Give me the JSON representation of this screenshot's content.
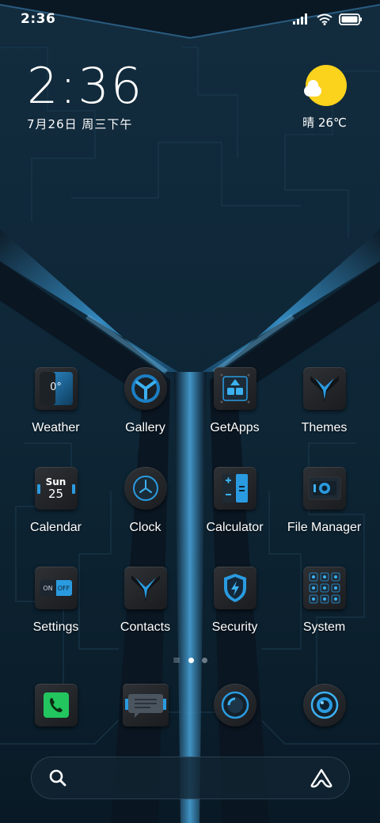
{
  "status_bar": {
    "time": "2:36",
    "icons": [
      "signal-icon",
      "wifi-icon",
      "battery-icon"
    ]
  },
  "clock_widget": {
    "time": "2:36",
    "date": "7月26日 周三下午"
  },
  "weather_widget": {
    "icon": "sun-cloud-icon",
    "text": "晴 26℃"
  },
  "apps": [
    [
      {
        "label": "Weather",
        "icon": "weather-icon",
        "badge": "0°"
      },
      {
        "label": "Gallery",
        "icon": "gallery-icon"
      },
      {
        "label": "GetApps",
        "icon": "getapps-icon"
      },
      {
        "label": "Themes",
        "icon": "themes-icon"
      }
    ],
    [
      {
        "label": "Calendar",
        "icon": "calendar-icon",
        "day_name": "Sun",
        "day_number": "25"
      },
      {
        "label": "Clock",
        "icon": "clock-icon"
      },
      {
        "label": "Calculator",
        "icon": "calculator-icon"
      },
      {
        "label": "File Manager",
        "icon": "file-manager-icon"
      }
    ],
    [
      {
        "label": "Settings",
        "icon": "settings-icon",
        "toggle_on": "ON",
        "toggle_off": "OFF"
      },
      {
        "label": "Contacts",
        "icon": "contacts-icon"
      },
      {
        "label": "Security",
        "icon": "security-icon"
      },
      {
        "label": "System",
        "icon": "system-folder-icon"
      }
    ]
  ],
  "page_indicator": {
    "menu_glyph": "≡",
    "pages": 2,
    "active_page": 1
  },
  "dock": [
    {
      "icon": "phone-icon"
    },
    {
      "icon": "messages-icon"
    },
    {
      "icon": "browser-icon"
    },
    {
      "icon": "camera-icon"
    }
  ],
  "search_bar": {
    "left_icon": "search-icon",
    "right_icon": "assistant-icon"
  },
  "colors": {
    "accent_blue": "#2aa3e6",
    "sun_yellow": "#fbd21c",
    "phone_green": "#22c55e",
    "wallpaper_dark": "#0b1f2e"
  }
}
